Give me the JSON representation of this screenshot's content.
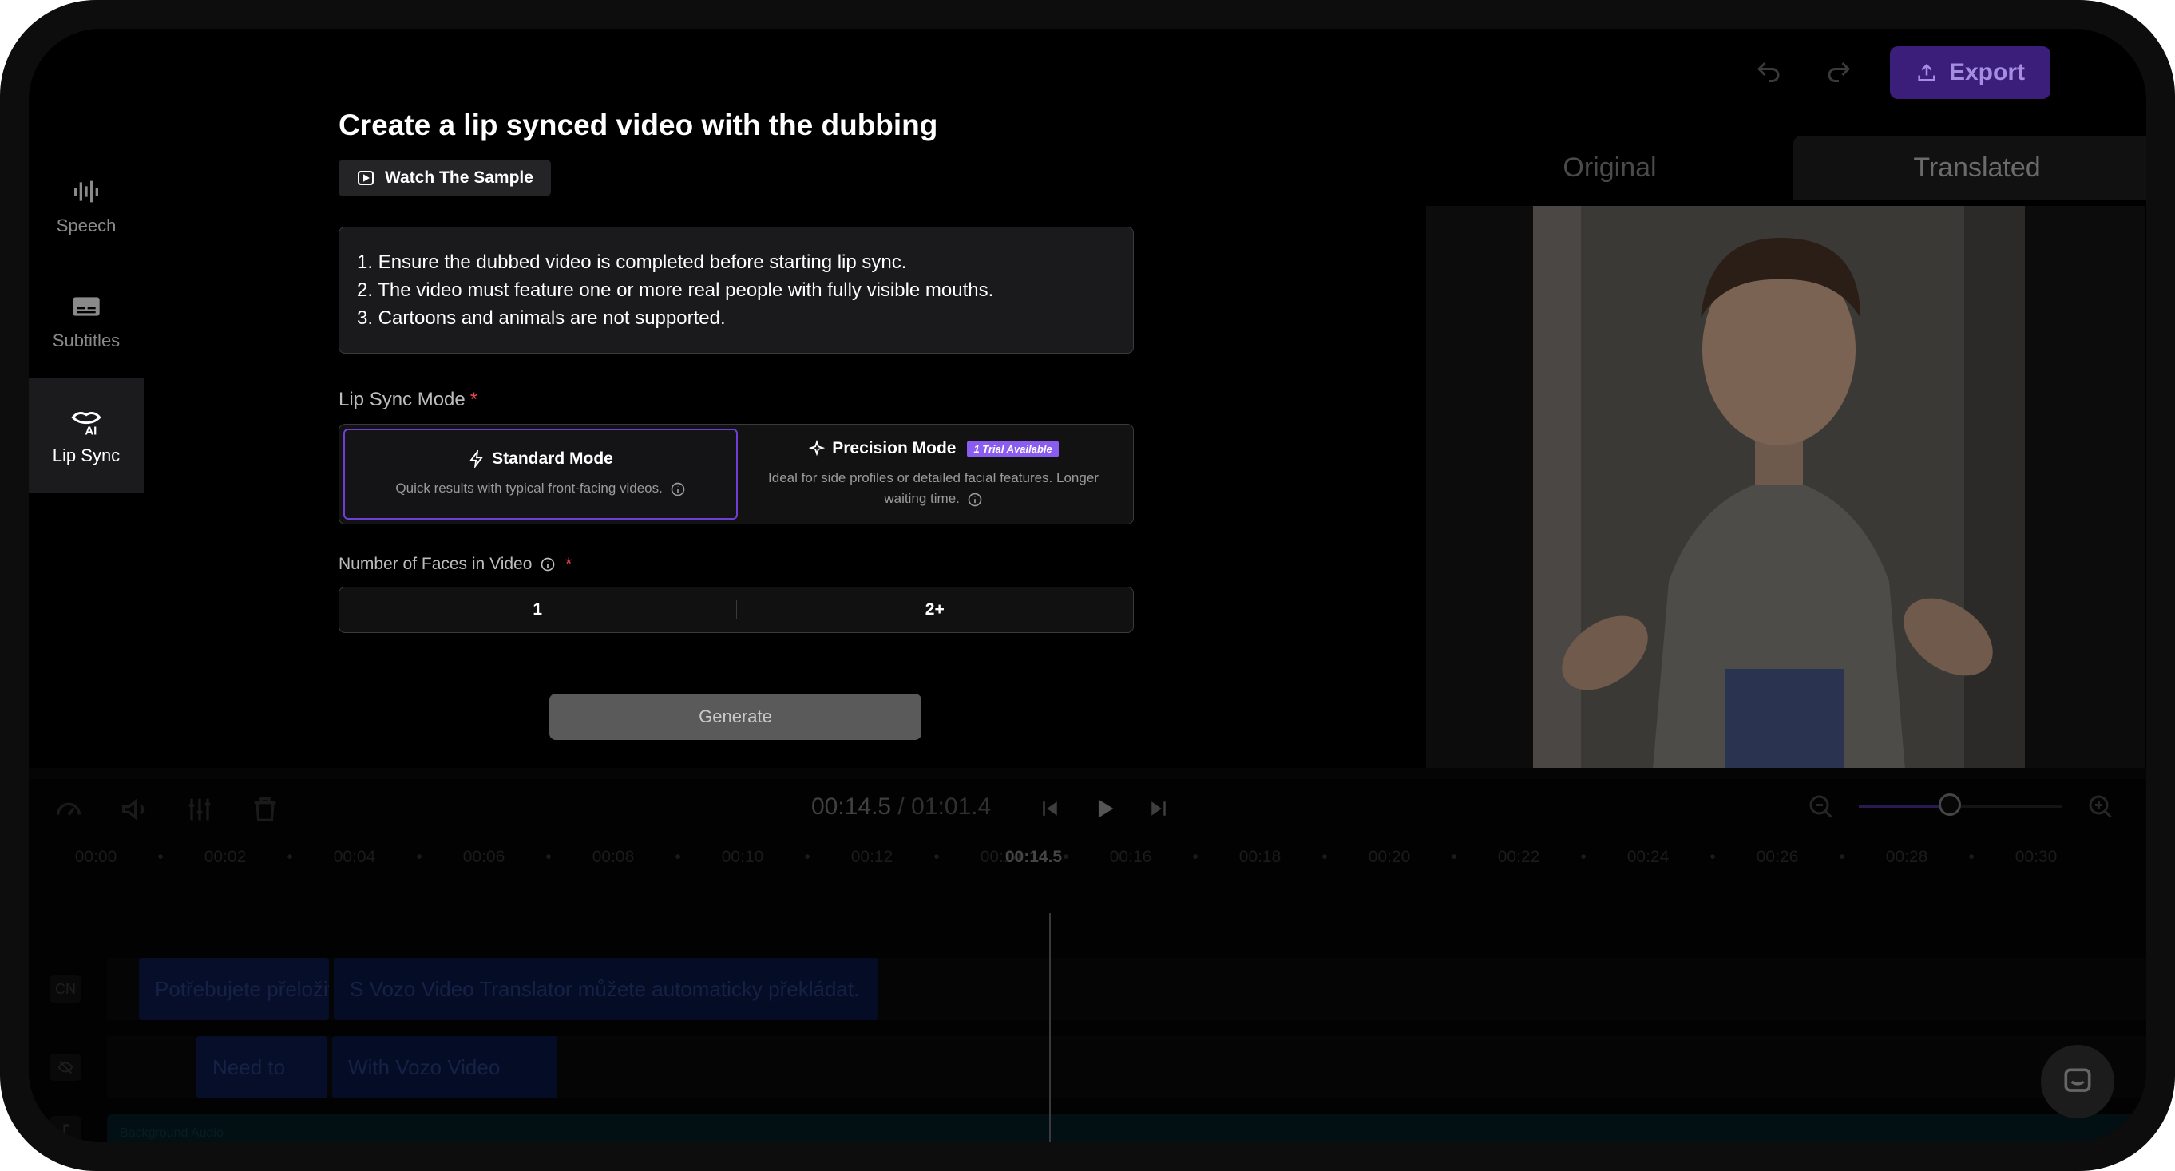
{
  "app": {
    "export_label": "Export",
    "accent": "#6d3fd6"
  },
  "sidebar": {
    "items": [
      {
        "label": "Speech",
        "icon": "waveform-icon",
        "active": false
      },
      {
        "label": "Subtitles",
        "icon": "subtitles-icon",
        "active": false
      },
      {
        "label": "Lip Sync",
        "icon": "ai-lips-icon",
        "active": true
      }
    ]
  },
  "panel": {
    "title": "Create a lip synced video with the dubbing",
    "sample_label": "Watch The Sample",
    "notes": [
      "1. Ensure the dubbed video is completed before starting lip sync.",
      "2. The video must feature one or more real people with fully visible mouths.",
      "3. Cartoons and animals are not supported."
    ],
    "mode_label": "Lip Sync Mode",
    "required_mark": "*",
    "modes": [
      {
        "name": "Standard Mode",
        "desc": "Quick results with typical front-facing videos.",
        "selected": true
      },
      {
        "name": "Precision Mode",
        "badge": "1 Trial Available",
        "desc": "Ideal for side profiles or detailed facial features. Longer waiting time.",
        "selected": false
      }
    ],
    "faces_label": "Number of Faces in Video",
    "faces_options": [
      "1",
      "2+"
    ],
    "generate_label": "Generate"
  },
  "preview": {
    "tabs": [
      "Original",
      "Translated"
    ],
    "active_tab": "Translated"
  },
  "timeline": {
    "current_time": "00:14.5",
    "separator": " / ",
    "total_time": "01:01.4",
    "ruler_ticks": [
      "00:00",
      "00:02",
      "00:04",
      "00:06",
      "00:08",
      "00:10",
      "00:12",
      "00:14",
      "00:16",
      "00:18",
      "00:20",
      "00:22",
      "00:24",
      "00:26",
      "00:28",
      "00:30"
    ],
    "playhead_label": "00:14.5",
    "zoom_level": 0.45,
    "tracks": [
      {
        "label": "CN",
        "clips": [
          "Potřebujete přeložit",
          "S Vozo Video Translator můžete automaticky překládat."
        ]
      },
      {
        "label": "",
        "clips": [
          "Need to",
          "With Vozo Video"
        ]
      },
      {
        "label": "",
        "clips": [
          "Background Audio"
        ]
      }
    ]
  }
}
